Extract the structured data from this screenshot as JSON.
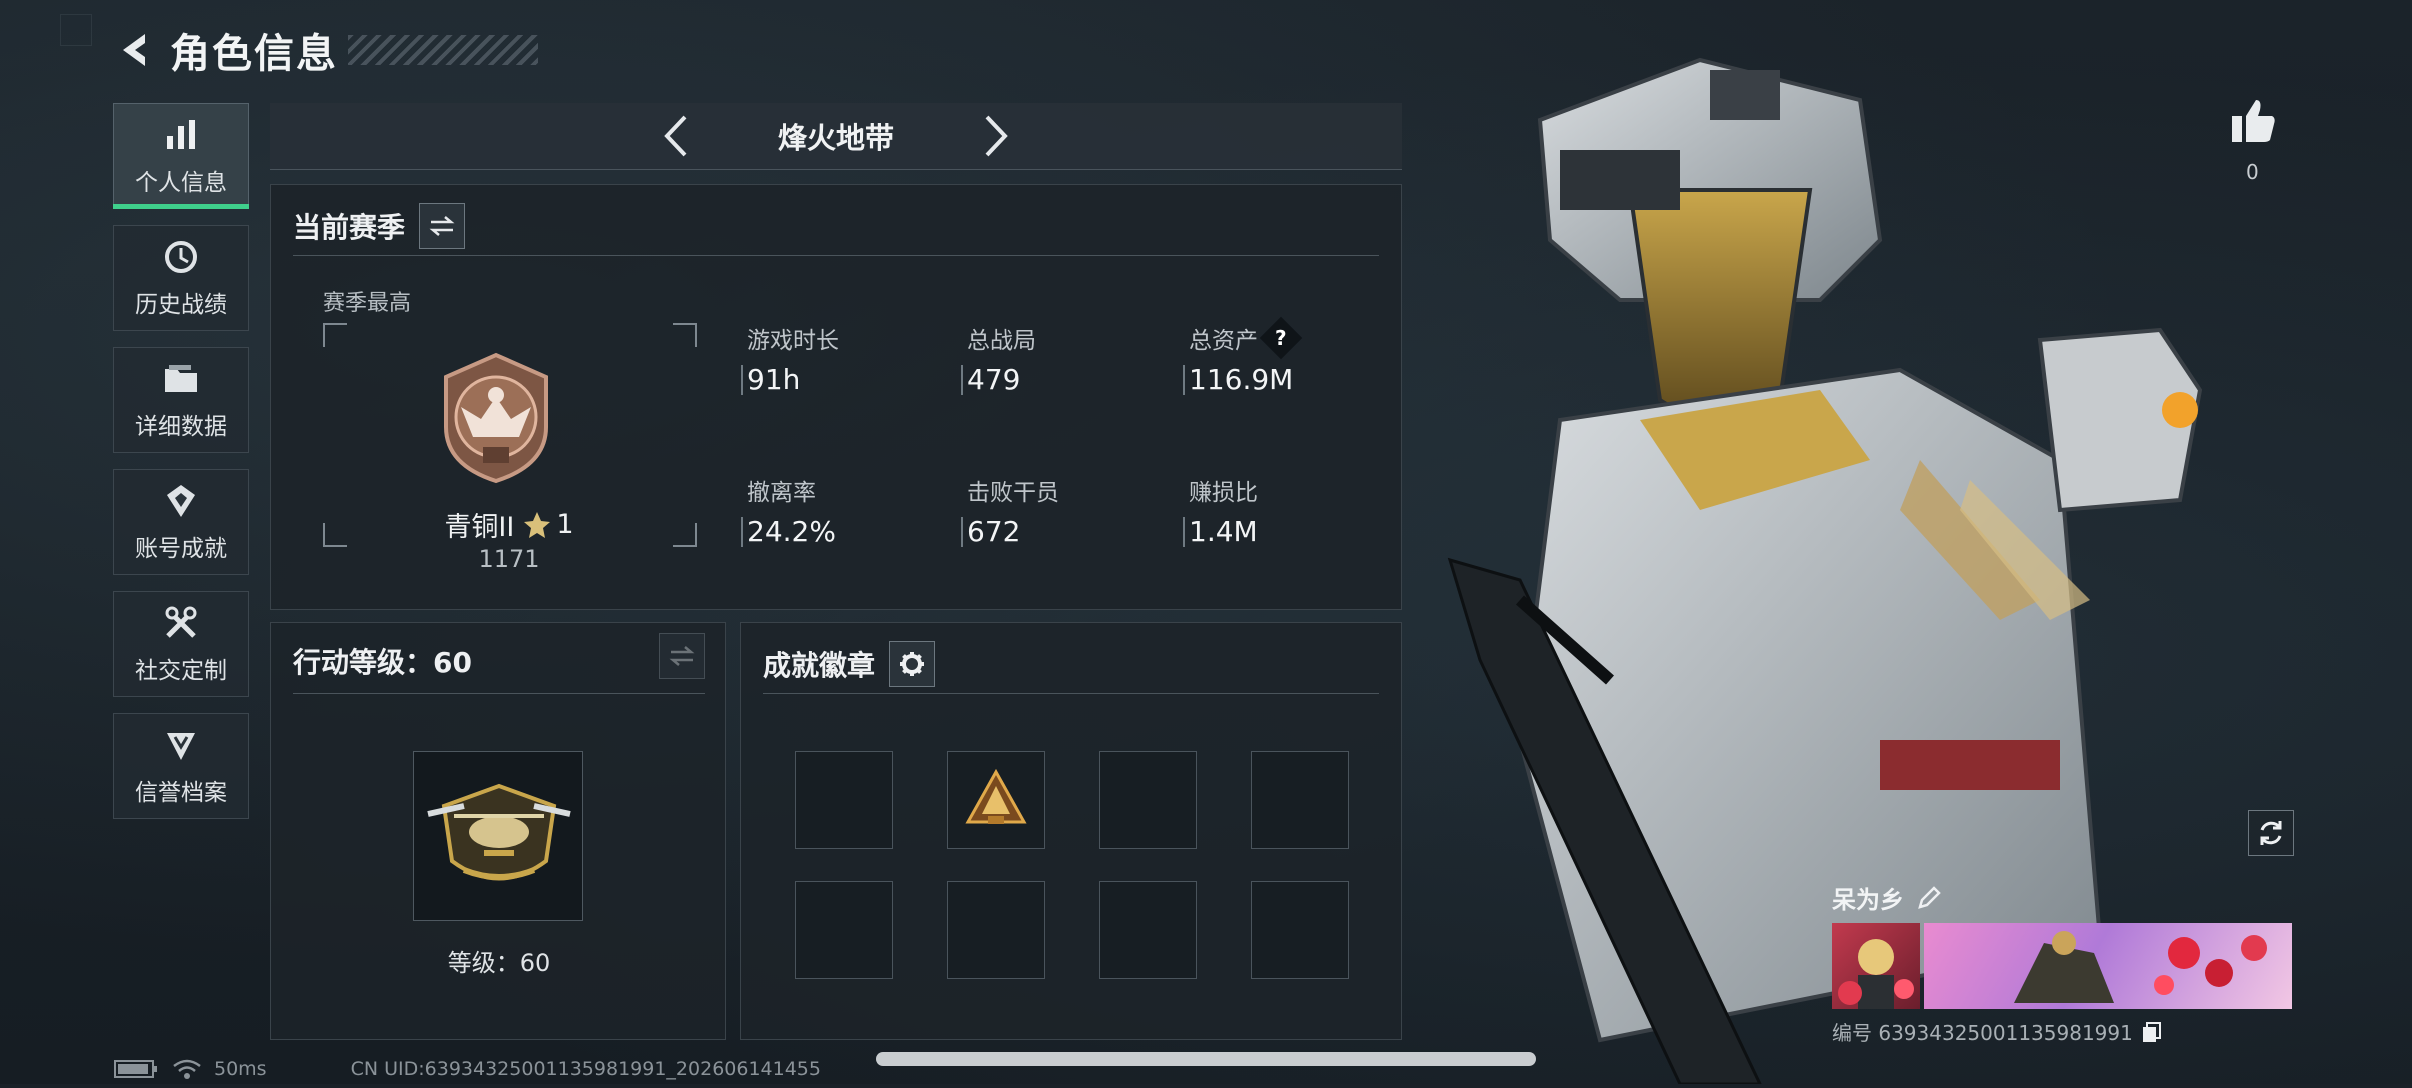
{
  "header": {
    "title": "角色信息"
  },
  "sidebar": {
    "items": [
      {
        "label": "个人信息",
        "icon": "bar-chart-icon",
        "active": true
      },
      {
        "label": "历史战绩",
        "icon": "history-clock-icon",
        "active": false
      },
      {
        "label": "详细数据",
        "icon": "folder-icon",
        "active": false
      },
      {
        "label": "账号成就",
        "icon": "achievement-icon",
        "active": false
      },
      {
        "label": "社交定制",
        "icon": "tools-icon",
        "active": false
      },
      {
        "label": "信誉档案",
        "icon": "reputation-icon",
        "active": false
      }
    ]
  },
  "mode": {
    "title": "烽火地带"
  },
  "season": {
    "title": "当前赛季",
    "best_label": "赛季最高",
    "rank_name": "青铜II",
    "rank_stars": "1",
    "rank_points": "1171",
    "stats": [
      {
        "label": "游戏时长",
        "value": "91h"
      },
      {
        "label": "总战局",
        "value": "479"
      },
      {
        "label": "总资产",
        "value": "116.9M"
      },
      {
        "label": "撤离率",
        "value": "24.2%"
      },
      {
        "label": "击败干员",
        "value": "672"
      },
      {
        "label": "赚损比",
        "value": "1.4M"
      }
    ],
    "help_symbol": "?"
  },
  "action_level": {
    "title": "行动等级：60",
    "level_text": "等级：60"
  },
  "badges": {
    "title": "成就徽章"
  },
  "character": {
    "like_count": "0",
    "player_name": "呆为乡",
    "player_id": "编号 6393432500113598199​1"
  },
  "status_bar": {
    "ping": "50ms",
    "uid": "CN UID:6393432500113598199​1_202606141455"
  },
  "colors": {
    "accent": "#3fd08c",
    "gold": "#c9a64b",
    "bronze": "#9c6f57"
  }
}
